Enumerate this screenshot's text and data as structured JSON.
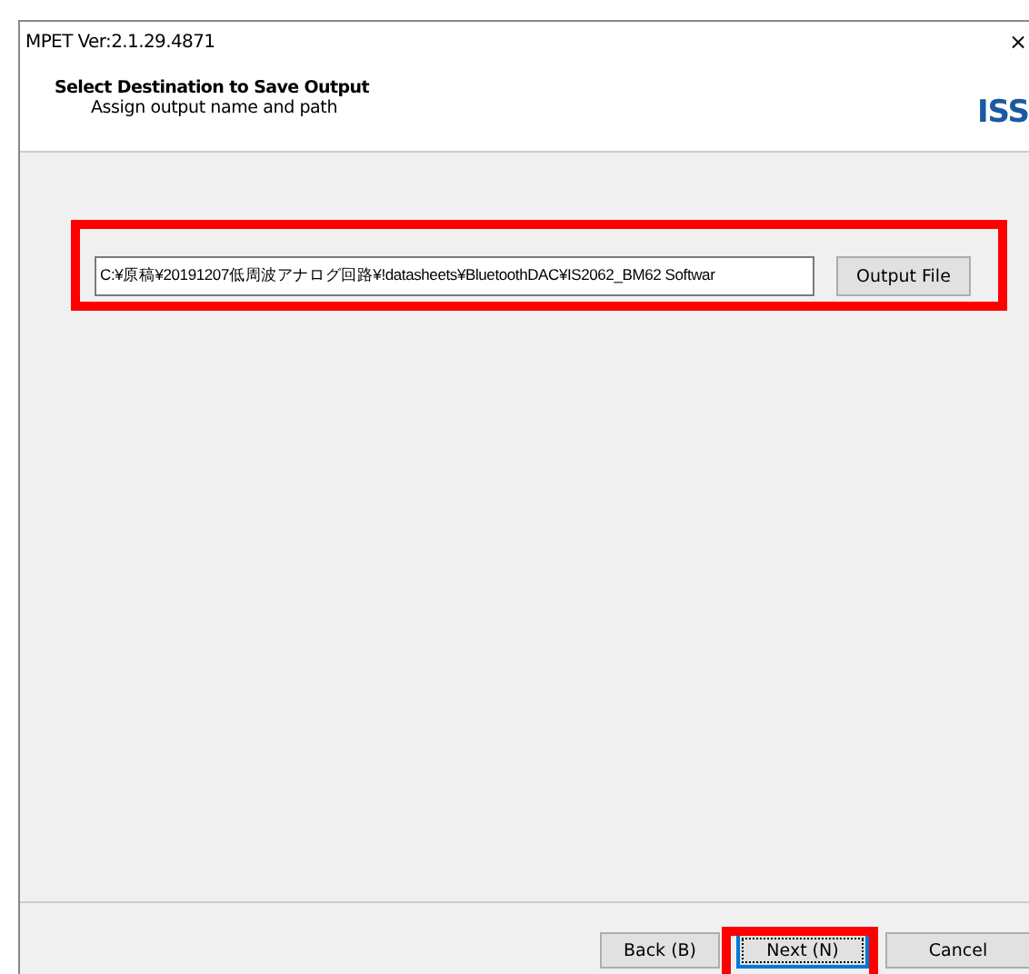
{
  "window": {
    "title": "MPET Ver:2.1.29.4871",
    "close": "×"
  },
  "header": {
    "title": "Select Destination to Save Output",
    "subtitle": "Assign output name and path",
    "logo": "ISS"
  },
  "output": {
    "value": "C:¥原稿¥20191207低周波アナログ回路¥!datasheets¥BluetoothDAC¥IS2062_BM62 Softwar",
    "button": "Output File",
    "highlighted": true
  },
  "buttons": [
    {
      "label": "Back (B)",
      "focused": false,
      "highlighted": false
    },
    {
      "label": "Next (N)",
      "focused": true,
      "highlighted": true
    },
    {
      "label": "Cancel",
      "focused": false,
      "highlighted": false
    }
  ]
}
